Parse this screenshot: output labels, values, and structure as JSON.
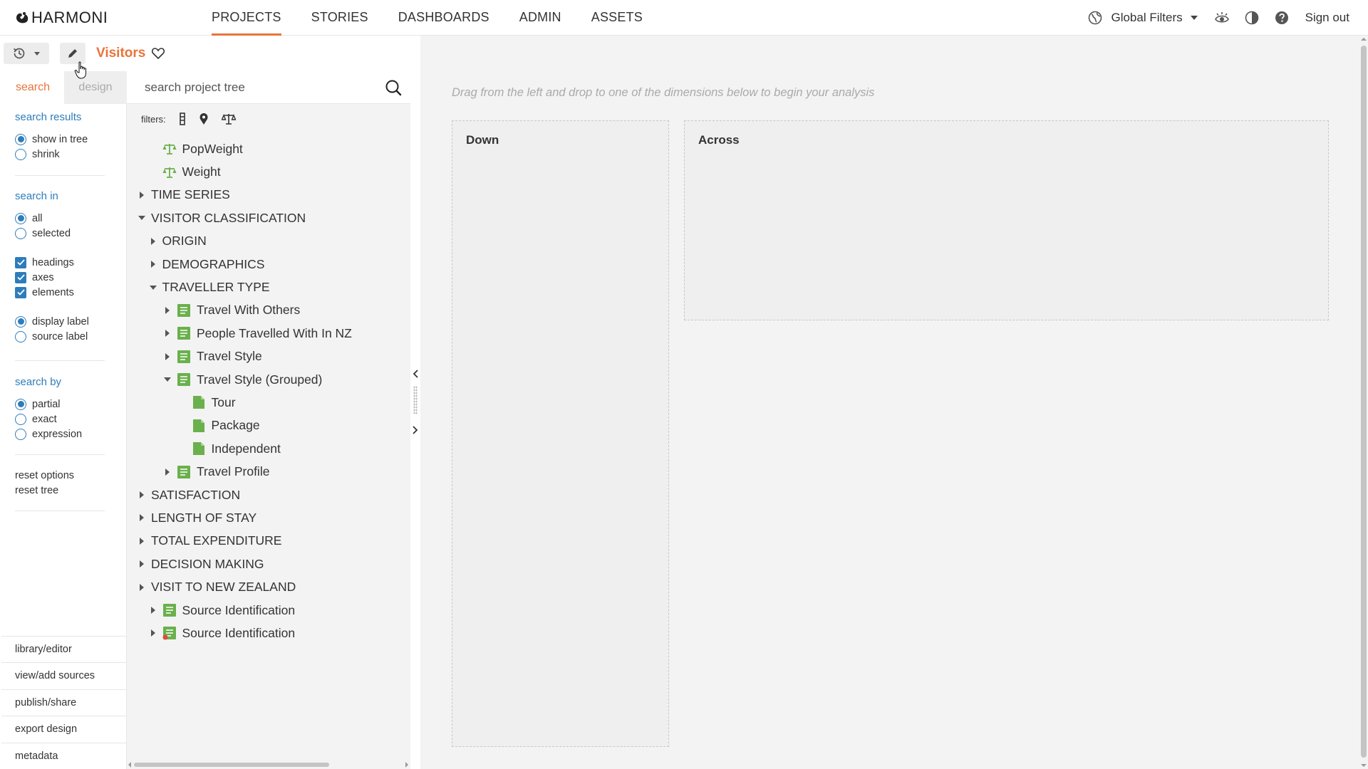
{
  "app": {
    "logo_text": "HARMONI"
  },
  "nav": {
    "items": [
      {
        "label": "PROJECTS",
        "active": true
      },
      {
        "label": "STORIES",
        "active": false
      },
      {
        "label": "DASHBOARDS",
        "active": false
      },
      {
        "label": "ADMIN",
        "active": false
      },
      {
        "label": "ASSETS",
        "active": false
      }
    ]
  },
  "topright": {
    "global_filters": "Global Filters",
    "sign_out": "Sign out"
  },
  "project": {
    "title": "Visitors"
  },
  "options": {
    "tabs": [
      {
        "label": "search",
        "active": true
      },
      {
        "label": "design",
        "active": false
      }
    ],
    "search_results": {
      "heading": "search results",
      "items": [
        {
          "label": "show in tree",
          "checked": true
        },
        {
          "label": "shrink",
          "checked": false
        }
      ]
    },
    "search_in": {
      "heading": "search in",
      "scope": [
        {
          "label": "all",
          "checked": true
        },
        {
          "label": "selected",
          "checked": false
        }
      ],
      "types": [
        {
          "label": "headings",
          "checked": true
        },
        {
          "label": "axes",
          "checked": true
        },
        {
          "label": "elements",
          "checked": true
        }
      ],
      "labels": [
        {
          "label": "display label",
          "checked": true
        },
        {
          "label": "source label",
          "checked": false
        }
      ]
    },
    "search_by": {
      "heading": "search by",
      "items": [
        {
          "label": "partial",
          "checked": true
        },
        {
          "label": "exact",
          "checked": false
        },
        {
          "label": "expression",
          "checked": false
        }
      ]
    },
    "reset": {
      "options": "reset options",
      "tree": "reset tree"
    },
    "bottom_links": [
      "library/editor",
      "view/add sources",
      "publish/share",
      "export design",
      "metadata"
    ]
  },
  "tree_panel": {
    "search_placeholder": "search project tree",
    "filters_label": "filters:",
    "nodes": [
      {
        "label": "PopWeight",
        "depth": 1,
        "toggle": "none",
        "icon": "weight-icon"
      },
      {
        "label": "Weight",
        "depth": 1,
        "toggle": "none",
        "icon": "weight-icon"
      },
      {
        "label": "TIME SERIES",
        "depth": 0,
        "toggle": "collapsed",
        "icon": "none"
      },
      {
        "label": "VISITOR CLASSIFICATION",
        "depth": 0,
        "toggle": "expanded",
        "icon": "none"
      },
      {
        "label": "ORIGIN",
        "depth": 1,
        "toggle": "collapsed",
        "icon": "none"
      },
      {
        "label": "DEMOGRAPHICS",
        "depth": 1,
        "toggle": "collapsed",
        "icon": "none"
      },
      {
        "label": "TRAVELLER TYPE",
        "depth": 1,
        "toggle": "expanded",
        "icon": "none"
      },
      {
        "label": "Travel With Others",
        "depth": 2,
        "toggle": "collapsed",
        "icon": "variable-icon"
      },
      {
        "label": "People Travelled With In NZ",
        "depth": 2,
        "toggle": "collapsed",
        "icon": "variable-icon"
      },
      {
        "label": "Travel Style",
        "depth": 2,
        "toggle": "collapsed",
        "icon": "variable-icon"
      },
      {
        "label": "Travel Style (Grouped)",
        "depth": 2,
        "toggle": "expanded",
        "icon": "variable-icon"
      },
      {
        "label": "Tour",
        "depth": 3,
        "toggle": "none",
        "icon": "code-icon"
      },
      {
        "label": "Package",
        "depth": 3,
        "toggle": "none",
        "icon": "code-icon"
      },
      {
        "label": "Independent",
        "depth": 3,
        "toggle": "none",
        "icon": "code-icon"
      },
      {
        "label": "Travel Profile",
        "depth": 2,
        "toggle": "collapsed",
        "icon": "variable-icon"
      },
      {
        "label": "SATISFACTION",
        "depth": 0,
        "toggle": "collapsed",
        "icon": "none"
      },
      {
        "label": "LENGTH OF STAY",
        "depth": 0,
        "toggle": "collapsed",
        "icon": "none"
      },
      {
        "label": "TOTAL EXPENDITURE",
        "depth": 0,
        "toggle": "collapsed",
        "icon": "none"
      },
      {
        "label": "DECISION MAKING",
        "depth": 0,
        "toggle": "collapsed",
        "icon": "none"
      },
      {
        "label": "VISIT TO NEW ZEALAND",
        "depth": 0,
        "toggle": "collapsed",
        "icon": "none"
      },
      {
        "label": "Source Identification",
        "depth": 1,
        "toggle": "collapsed",
        "icon": "variable-icon"
      },
      {
        "label": "Source Identification",
        "depth": 1,
        "toggle": "collapsed",
        "icon": "variable-red-icon"
      }
    ]
  },
  "workspace": {
    "hint": "Drag from the left and drop to one of the dimensions below to begin your analysis",
    "down_label": "Down",
    "across_label": "Across"
  },
  "colors": {
    "accent": "#e8743b",
    "link_blue": "#2e7dbb",
    "green": "#6ab04c",
    "red": "#e04a3f"
  }
}
